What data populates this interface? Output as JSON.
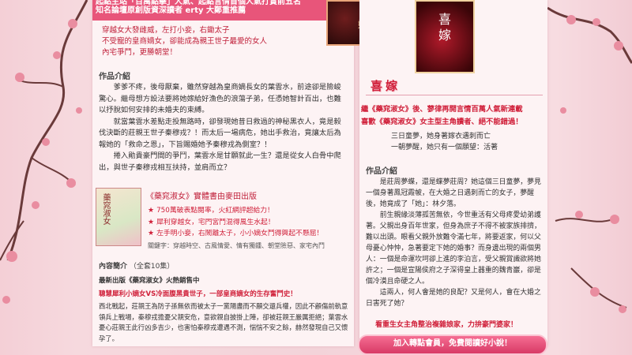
{
  "colors": {
    "accent_red": "#d0203a",
    "pink_banner": "#e8557a",
    "panel_bg": "#fdf3f4",
    "page_bg": "#f4cfd6"
  },
  "left": {
    "top_banner": {
      "line1": "起點主站「百萬點擊」人氣、起點言情首個人氣打賞前五名",
      "line2": "知名論壇原創版資深讀者 erty 大鄭重推薦"
    },
    "tagline": [
      "穿越女大發雌威，左打小妾，右鋤太子",
      "不受寵的皇商嫡女，卻能成為親王世子最愛的女人",
      "內宅爭鬥，更勝朝堂！"
    ],
    "intro_title": "作品介紹",
    "intro_paragraphs": [
      "爹爹不疼，後母厭棄，雖然穿越為皇商嫡長女的葉雲水，前途卻是險峻驚心。繼母想方設法要將她嫁給好漁色的浪蕩子弟，任憑她智計百出，也難以抒脫如何安排的未婚夫的束縛。",
      "就當葉雲水差點走投無路時，卻發現她昔日救過的神秘黑衣人，竟是毅伐決斷的莊親王世子秦穆戎？！而太后一場病危，她出手救治，竟讓太后為報她的「救命之恩」，下旨賜婚她予秦穆戎為側室？！",
      "捲入勛貴豪門間的爭鬥，葉雲水是甘願就此一生？還是從女人白骨中爬出，與世子秦穆戎相互扶持，並肩而立？"
    ],
    "promo": {
      "title": "《藥窕淑女》實體書由麥田出版",
      "bullets": [
        "750萬破表點閱率，火紅網評超給力！",
        "犀利穿越女，宅門宮鬥混得風生水起！",
        "左手明小妾，右鬧離太子，小小嫡女鬥得興起不懸屈！"
      ],
      "tags": "關鍵字：穿越時空、古風情愛、情有獨鍾、朝堂險惡、家宅內鬥"
    },
    "content_title": "內容簡介",
    "content_count": "（全套10集）",
    "latest": "最新出版《藥窕淑女》火熱銷售中",
    "highlight": "聰慧犀利小嫡女VS冷面腹黑貴世子，一部皇商嫡女的生存奮鬥史！",
    "summary": "西北戰起，莊親王為防子孫無依而被太子一黨陽盡而不願交還兵權，因此不顧傷前軌意領兵上戰場，秦穆戎擔憂父親安危，意欲親自披掛上陣，卻被莊親王嚴厲拒絕；葉雲水憂心莊親王此行凶多吉少，也害怕秦穆戎遭遇不測，惴惴不安之餘，赫然發現自己又懷孕了。",
    "cover_title": "藥窕淑女"
  },
  "right": {
    "cover_title": "喜嫁",
    "cover_small": "嫁",
    "logo_text": "喜嫁",
    "headline1": "繼《藥窕淑女》後、蓼律再開言情百萬人氣新連載",
    "headline2": "喜歡《藥窕淑女》女主型主角讀者、絕不能錯過！",
    "sub": [
      "三日童夢，她身著嫁衣遇刺而亡",
      "一朝夢醒，她只有一個願望：活著"
    ],
    "intro_title": "作品介紹",
    "paragraphs": [
      "是莊周夢蝶，還是蝶夢莊周？她這個三日童夢，夢見一個身著鳳冠霞帔，在大婚之日遇刺而亡的女子，夢醒後，她竟成了「她」：林夕落。",
      "前生親緣淡薄孤苦無依，今世重活有父母疼愛幼弟護著。父親出身百年世家，但身為庶子不得不被家族排擠，難以出頭。眼看父親外放難令滿七年，將要返家，何以父母憂心忡忡，急著要定下她的婚事？而身邊出現的兩個男人：一個是命運坎坷卻上進的李泊言，受父親賞識欲將她許之；一個是宣陽侯府之子深得皇上器重的魏青巖，卻是個冷漠且命硬之人。",
      "這兩人，何人會是她的良配？又是何人，會在大婚之日害死了她？"
    ],
    "closing": "看重生女主角整治複雜娘家，力拚豪門婆家！",
    "button": "加入轉點會員，免費閱讀好小說！"
  }
}
